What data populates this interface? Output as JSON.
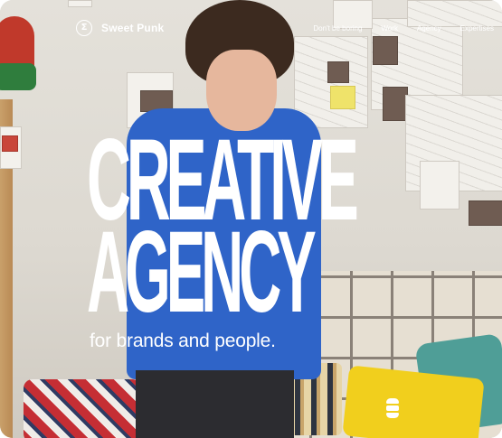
{
  "brand": {
    "name": "Sweet Punk",
    "logo_glyph": "Σ"
  },
  "nav": {
    "items": [
      {
        "label": "Don't be boring"
      },
      {
        "label": "Work"
      },
      {
        "label": "Agency"
      },
      {
        "label": "Expertises"
      }
    ]
  },
  "hero": {
    "title_line1": "CREATIVE",
    "title_line2": "AGENCY",
    "tagline": "for brands and people."
  },
  "colors": {
    "text": "#ffffff",
    "shirt": "#2f64c8",
    "pillow_yellow": "#f1cf1d",
    "pillow_teal": "#4f9e97"
  },
  "icons": {
    "scroll": "stacked-shape-icon"
  }
}
